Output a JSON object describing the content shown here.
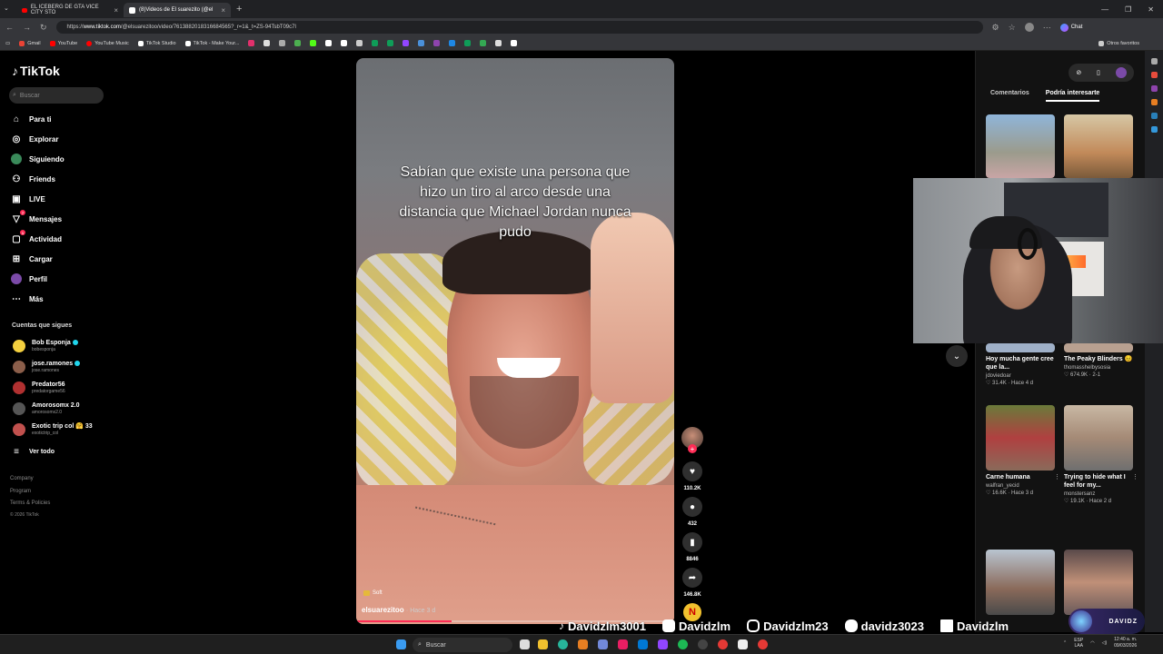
{
  "browser": {
    "tabs": [
      {
        "label": "EL ICEBERG DE GTA VICE CITY STO",
        "kind": "youtube"
      },
      {
        "label": "(8)Videos de El suarezito (@el",
        "kind": "tiktok"
      }
    ],
    "url_prefix": "https://",
    "url_domain": "www.tiktok.com",
    "url_rest": "/@elsuarezitoo/video/7613882018316684565?_r=1&_t=ZS-94TsbT09c7l",
    "bookmarks": [
      {
        "label": "Gmail",
        "color": "#ea4335"
      },
      {
        "label": "YouTube",
        "color": "#ff0000"
      },
      {
        "label": "YouTube Music",
        "color": "#ff0000"
      },
      {
        "label": "TikTok Studio",
        "color": "#ffffff"
      },
      {
        "label": "TikTok - Make Your...",
        "color": "#ffffff"
      }
    ],
    "other_bookmarks": "Otros favoritos",
    "chat": "Chat"
  },
  "nav": {
    "logo": "TikTok",
    "search_placeholder": "Buscar",
    "items": [
      {
        "label": "Para ti",
        "icon": "home-icon"
      },
      {
        "label": "Explorar",
        "icon": "compass-icon"
      },
      {
        "label": "Siguiendo",
        "icon": "following-icon"
      },
      {
        "label": "Friends",
        "icon": "friends-icon"
      },
      {
        "label": "LIVE",
        "icon": "live-icon"
      },
      {
        "label": "Mensajes",
        "icon": "messages-icon",
        "badge": "7"
      },
      {
        "label": "Actividad",
        "icon": "activity-icon",
        "badge": "1"
      },
      {
        "label": "Cargar",
        "icon": "upload-icon"
      },
      {
        "label": "Perfil",
        "icon": "profile-icon"
      },
      {
        "label": "Más",
        "icon": "more-icon"
      }
    ],
    "following_title": "Cuentas que sigues",
    "accounts": [
      {
        "name": "Bob Esponja",
        "user": "bobesponja",
        "verified": true,
        "color": "#f4d03f"
      },
      {
        "name": "jose.ramones",
        "user": "jose.ramones",
        "verified": true,
        "color": "#8b5e4a"
      },
      {
        "name": "Predator56",
        "user": "predatorgame56",
        "verified": false,
        "color": "#b03030"
      },
      {
        "name": "Amorosomx 2.0",
        "user": "amorosomx2.0",
        "verified": false,
        "color": "#555555"
      },
      {
        "name": "Exotic trip col 🤗 33",
        "user": "exotictrip_col",
        "verified": false,
        "color": "#c0504d"
      }
    ],
    "see_all": "Ver todo",
    "footer": [
      "Company",
      "Program",
      "Terms & Policies",
      "© 2026 TikTok"
    ]
  },
  "video": {
    "caption": "Sabían que existe una persona que hizo un tiro al arco desde una distancia que Michael Jordan nunca pudo",
    "sound_tag": "Soft",
    "author": "elsuarezitoo",
    "posted": "· Hace 3 d",
    "progress": 0.3
  },
  "actions": {
    "likes": "110.2K",
    "comments": "432",
    "saves": "8846",
    "shares": "146.8K"
  },
  "panel": {
    "tab_comments": "Comentarios",
    "tab_suggested": "Podría interesarte",
    "cards": [
      {
        "title": "Hoy mucha gente cree que la...",
        "user": "jdoviedoar",
        "stats": "♡ 31.4K · Hace 4 d"
      },
      {
        "title": "The Peaky Blinders 😣",
        "user": "thomasshelbysosia",
        "stats": "♡ 674.9K · 2-1"
      },
      {
        "title": "Carne humana",
        "user": "walfran_yecid",
        "stats": "♡ 16.6K · Hace 3 d"
      },
      {
        "title": "Trying to hide what I feel for my...",
        "user": "monstersanz",
        "stats": "♡ 19.1K · Hace 2 d"
      }
    ]
  },
  "overlay": {
    "socials": [
      {
        "platform": "tiktok",
        "handle": "Davidzlm3001"
      },
      {
        "platform": "youtube",
        "handle": "Davidzlm"
      },
      {
        "platform": "instagram",
        "handle": "Davidzlm23"
      },
      {
        "platform": "discord",
        "handle": "davidz3023"
      },
      {
        "platform": "kick",
        "handle": "Davidzlm"
      }
    ],
    "logo_text": "DAVIDZ"
  },
  "taskbar": {
    "search": "Buscar",
    "lang_top": "ESP",
    "lang_bottom": "LAA",
    "time": "12:40 a. m.",
    "date": "09/03/2026"
  }
}
